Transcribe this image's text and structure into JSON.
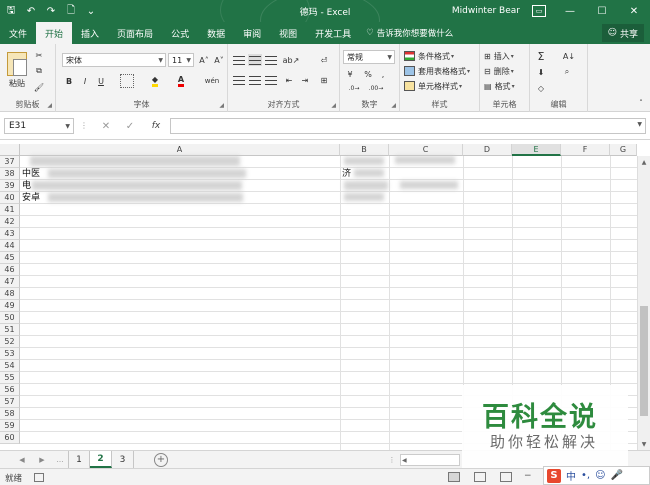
{
  "titlebar": {
    "title": "德玛 - Excel",
    "user": "Midwinter Bear",
    "qat": {
      "save": "🖫",
      "undo": "↶",
      "redo": "↷",
      "new": "🗋",
      "more": "⌄"
    },
    "window": {
      "options": "▭",
      "minimize": "—",
      "maximize": "☐",
      "close": "✕"
    }
  },
  "tabs": [
    "文件",
    "开始",
    "插入",
    "页面布局",
    "公式",
    "数据",
    "审阅",
    "视图",
    "开发工具"
  ],
  "active_tab": "开始",
  "tellme": "告诉我你想要做什么",
  "share": "共享",
  "ribbon": {
    "clipboard": {
      "label": "剪贴板",
      "paste": "粘贴"
    },
    "font": {
      "label": "字体",
      "name": "宋体",
      "size": "11",
      "grow": "A˄",
      "shrink": "A˅",
      "bold": "B",
      "italic": "I",
      "underline": "U",
      "phonetic": "wén"
    },
    "alignment": {
      "label": "对齐方式"
    },
    "number": {
      "label": "数字",
      "format": "常规",
      "percent": "%",
      "comma": ","
    },
    "styles": {
      "label": "样式",
      "conditional": "条件格式",
      "table": "套用表格格式",
      "cell": "单元格样式"
    },
    "cells": {
      "label": "单元格",
      "insert": "插入",
      "delete": "删除",
      "format": "格式"
    },
    "editing": {
      "label": "编辑",
      "sum": "Σ"
    }
  },
  "formula_bar": {
    "name_box": "E31",
    "fx": "fx",
    "cancel": "✕",
    "enter": "✓"
  },
  "grid": {
    "columns": [
      "A",
      "B",
      "C",
      "D",
      "E",
      "F",
      "G"
    ],
    "selected_column": "E",
    "rows": [
      37,
      38,
      39,
      40,
      41,
      42,
      43,
      44,
      45,
      46,
      47,
      48,
      49,
      50,
      51,
      52,
      53,
      54,
      55,
      56,
      57,
      58,
      59,
      60
    ],
    "cells": {
      "a38": "中医",
      "a39": "电",
      "a40": "安卓",
      "b38": "济"
    }
  },
  "sheets": [
    "1",
    "2",
    "3"
  ],
  "active_sheet": "2",
  "add_sheet": "⊕",
  "status": {
    "ready": "就绪"
  },
  "watermark": {
    "title": "百科全说",
    "subtitle": "助你轻松解决"
  },
  "ime": {
    "logo": "S",
    "mode": "中",
    "dot": "•,",
    "emoji": "☺",
    "mic": "🎤"
  },
  "colors": {
    "excel_green": "#217346"
  }
}
